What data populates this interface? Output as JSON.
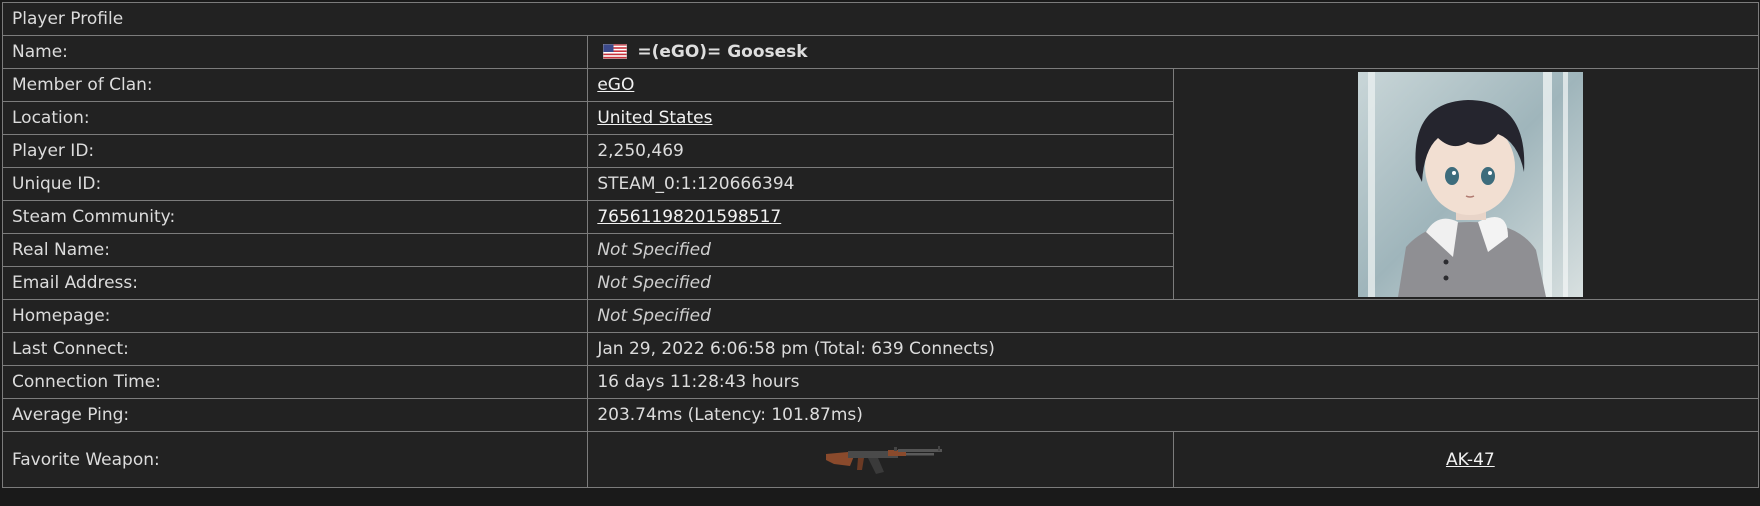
{
  "header": {
    "title": "Player Profile"
  },
  "rows": [
    {
      "label": "Name:",
      "value": "=(eGO)= Goosesk",
      "icon": "us-flag-icon"
    },
    {
      "label": "Member of Clan:",
      "value": "eGO"
    },
    {
      "label": "Location:",
      "value": "United States"
    },
    {
      "label": "Player ID:",
      "value": "2,250,469"
    },
    {
      "label": "Unique ID:",
      "value": "STEAM_0:1:120666394"
    },
    {
      "label": "Steam Community:",
      "value": "76561198201598517"
    },
    {
      "label": "Real Name:",
      "value": "Not Specified"
    },
    {
      "label": "Email Address:",
      "value": "Not Specified"
    },
    {
      "label": "Homepage:",
      "value": "Not Specified"
    },
    {
      "label": "Last Connect:",
      "value": "Jan 29, 2022 6:06:58 pm (Total: 639 Connects)"
    },
    {
      "label": "Connection Time:",
      "value": "16 days 11:28:43 hours"
    },
    {
      "label": "Average Ping:",
      "value": "203.74ms (Latency: 101.87ms)"
    },
    {
      "label": "Favorite Weapon:",
      "value": "AK-47",
      "icon": "ak47-weapon-icon"
    }
  ],
  "avatar": {
    "icon": "player-avatar-anime-portrait"
  },
  "colors": {
    "background": "#222222",
    "border": "#7c7c7c",
    "text": "#dcdcdc",
    "link": "#f2f2f2",
    "weapon_cell": "#6a6a6a"
  }
}
